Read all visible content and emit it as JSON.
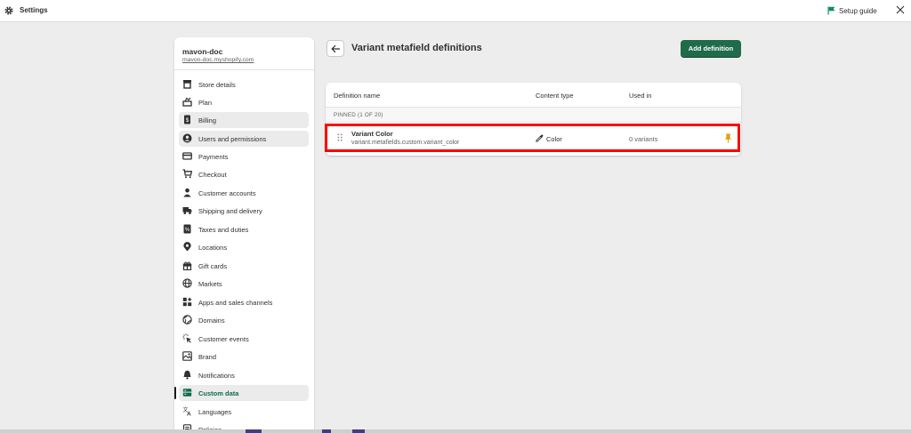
{
  "topbar": {
    "title": "Settings",
    "setup_guide": "Setup guide",
    "gear_icon": "gear-icon",
    "flag_icon": "flag-icon",
    "close_icon": "close-icon"
  },
  "store": {
    "name": "mavon-doc",
    "url": "mavon-doc.myshopify.com"
  },
  "sidebar": {
    "items": [
      {
        "label": "Store details",
        "icon": "store-icon"
      },
      {
        "label": "Plan",
        "icon": "plan-icon"
      },
      {
        "label": "Billing",
        "icon": "billing-icon"
      },
      {
        "label": "Users and permissions",
        "icon": "user-circle-icon"
      },
      {
        "label": "Payments",
        "icon": "payments-icon"
      },
      {
        "label": "Checkout",
        "icon": "cart-icon"
      },
      {
        "label": "Customer accounts",
        "icon": "person-icon"
      },
      {
        "label": "Shipping and delivery",
        "icon": "truck-icon"
      },
      {
        "label": "Taxes and duties",
        "icon": "tax-icon"
      },
      {
        "label": "Locations",
        "icon": "location-pin-icon"
      },
      {
        "label": "Gift cards",
        "icon": "gift-icon"
      },
      {
        "label": "Markets",
        "icon": "globe-icon"
      },
      {
        "label": "Apps and sales channels",
        "icon": "apps-icon"
      },
      {
        "label": "Domains",
        "icon": "domain-globe-icon"
      },
      {
        "label": "Customer events",
        "icon": "cursor-click-icon"
      },
      {
        "label": "Brand",
        "icon": "brand-icon"
      },
      {
        "label": "Notifications",
        "icon": "bell-icon"
      },
      {
        "label": "Custom data",
        "icon": "custom-data-icon"
      },
      {
        "label": "Languages",
        "icon": "translate-icon"
      },
      {
        "label": "Policies",
        "icon": "policy-icon"
      }
    ],
    "active_item": "Custom data"
  },
  "header": {
    "title": "Variant metafield definitions",
    "back_icon": "arrow-left-icon",
    "add_button": "Add definition"
  },
  "table": {
    "columns": [
      "Definition name",
      "Content type",
      "Used in"
    ],
    "group_label": "PINNED (1 OF 20)",
    "rows": [
      {
        "name": "Variant Color",
        "key": "variant.metafields.custom.variant_color",
        "content_type": "Color",
        "content_type_icon": "eyedropper-icon",
        "used_in": "0 variants",
        "pinned_icon": "pin-icon"
      }
    ]
  },
  "colors": {
    "primary_button": "#1f6b4b",
    "active_nav_text": "#0b6b4a",
    "highlight_border": "#ff0000",
    "pin": "#e0a100",
    "flag": "#0f8b6b"
  }
}
